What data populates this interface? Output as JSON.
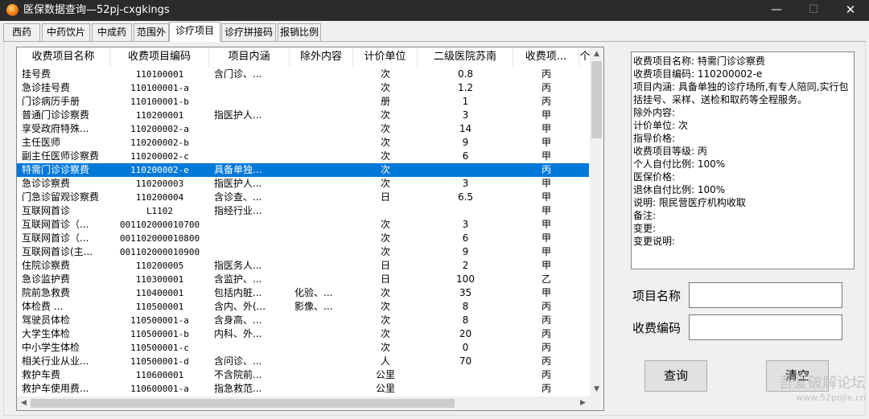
{
  "window": {
    "title": "医保数据查询—52pj-cxgkings",
    "min_glyph": "—",
    "max_glyph": "☐",
    "close_glyph": "✕"
  },
  "tabs": [
    {
      "label": "西药"
    },
    {
      "label": "中药饮片"
    },
    {
      "label": "中成药"
    },
    {
      "label": "范围外"
    },
    {
      "label": "诊疗项目"
    },
    {
      "label": "诊疗拼接码"
    },
    {
      "label": "报销比例"
    }
  ],
  "active_tab": "诊疗项目",
  "table": {
    "columns": [
      "收费项目名称",
      "收费项目编码",
      "项目内涵",
      "除外内容",
      "计价单位",
      "二级医院苏南",
      "收费项...",
      "个"
    ],
    "selected_row": 7,
    "rows": [
      [
        "挂号费",
        "110100001",
        "含门诊、...",
        "",
        "次",
        "0.8",
        "丙"
      ],
      [
        "急诊挂号费",
        "110100001-a",
        "",
        "",
        "次",
        "1.2",
        "丙"
      ],
      [
        "门诊病历手册",
        "110100001-b",
        "",
        "",
        "册",
        "1",
        "丙"
      ],
      [
        "普通门诊诊察费",
        "110200001",
        "指医护人...",
        "",
        "次",
        "3",
        "甲"
      ],
      [
        "享受政府特殊...",
        "110200002-a",
        "",
        "",
        "次",
        "14",
        "甲"
      ],
      [
        "主任医师",
        "110200002-b",
        "",
        "",
        "次",
        "9",
        "甲"
      ],
      [
        "副主任医师诊察费",
        "110200002-c",
        "",
        "",
        "次",
        "6",
        "甲"
      ],
      [
        "特需门诊诊察费",
        "110200002-e",
        "具备单独...",
        "",
        "次",
        "",
        "丙"
      ],
      [
        "急诊诊察费",
        "110200003",
        "指医护人...",
        "",
        "次",
        "3",
        "甲"
      ],
      [
        "门急诊留观诊察费",
        "110200004",
        "含诊查、...",
        "",
        "日",
        "6.5",
        "甲"
      ],
      [
        "互联网首诊",
        "L1102",
        "指经行业...",
        "",
        "",
        "",
        "甲"
      ],
      [
        "互联网首诊（...",
        "001102000010700",
        "",
        "",
        "次",
        "3",
        "甲"
      ],
      [
        "互联网首诊（...",
        "001102000010800",
        "",
        "",
        "次",
        "6",
        "甲"
      ],
      [
        "互联网首诊(主...",
        "001102000010900",
        "",
        "",
        "次",
        "9",
        "甲"
      ],
      [
        "住院诊察费",
        "110200005",
        "指医务人...",
        "",
        "日",
        "2",
        "甲"
      ],
      [
        "急诊监护费",
        "110300001",
        "含监护、...",
        "",
        "日",
        "100",
        "乙"
      ],
      [
        "院前急救费",
        "110400001",
        "包括内脏...",
        "化验、...",
        "次",
        "35",
        "甲"
      ],
      [
        "体检费      ...",
        "110500001",
        "含内、外(...",
        "影像、...",
        "次",
        "8",
        "丙"
      ],
      [
        "驾驶员体检",
        "110500001-a",
        "含身高、...",
        "",
        "次",
        "8",
        "丙"
      ],
      [
        "大学生体检",
        "110500001-b",
        "内科、外...",
        "",
        "次",
        "20",
        "丙"
      ],
      [
        "中小学生体检",
        "110500001-c",
        "",
        "",
        "次",
        "0",
        "丙"
      ],
      [
        "相关行业从业...",
        "110500001-d",
        "含问诊、...",
        "",
        "人",
        "70",
        "丙"
      ],
      [
        "救护车费",
        "110600001",
        "不含院前...",
        "",
        "公里",
        "",
        "丙"
      ],
      [
        "救护车使用费...",
        "110600001-a",
        "指急救范...",
        "",
        "公里",
        "",
        "丙"
      ]
    ]
  },
  "detail": {
    "lines": [
      "收费项目名称: 特需门诊诊察费",
      "收费项目编码: 110200002-e",
      "项目内涵: 具备单独的诊疗场所,有专人陪同,实行包括挂号、采样、送检和取药等全程服务。",
      "除外内容:",
      "计价单位: 次",
      "指导价格:",
      "收费项目等级: 丙",
      "个人自付比例: 100%",
      "医保价格:",
      "退休自付比例: 100%",
      "说明: 限民营医疗机构收取",
      "备注:",
      "变更:",
      "变更说明:"
    ]
  },
  "form": {
    "name_label": "项目名称",
    "name_value": "",
    "code_label": "收费编码",
    "code_value": ""
  },
  "buttons": {
    "query": "查询",
    "clear": "清空"
  },
  "watermark": {
    "text": "吾爱破解论坛",
    "url": "www.52pojie.cn"
  },
  "scroll": {
    "up": "▲",
    "down": "▼",
    "left": "◀",
    "right": "▶"
  }
}
